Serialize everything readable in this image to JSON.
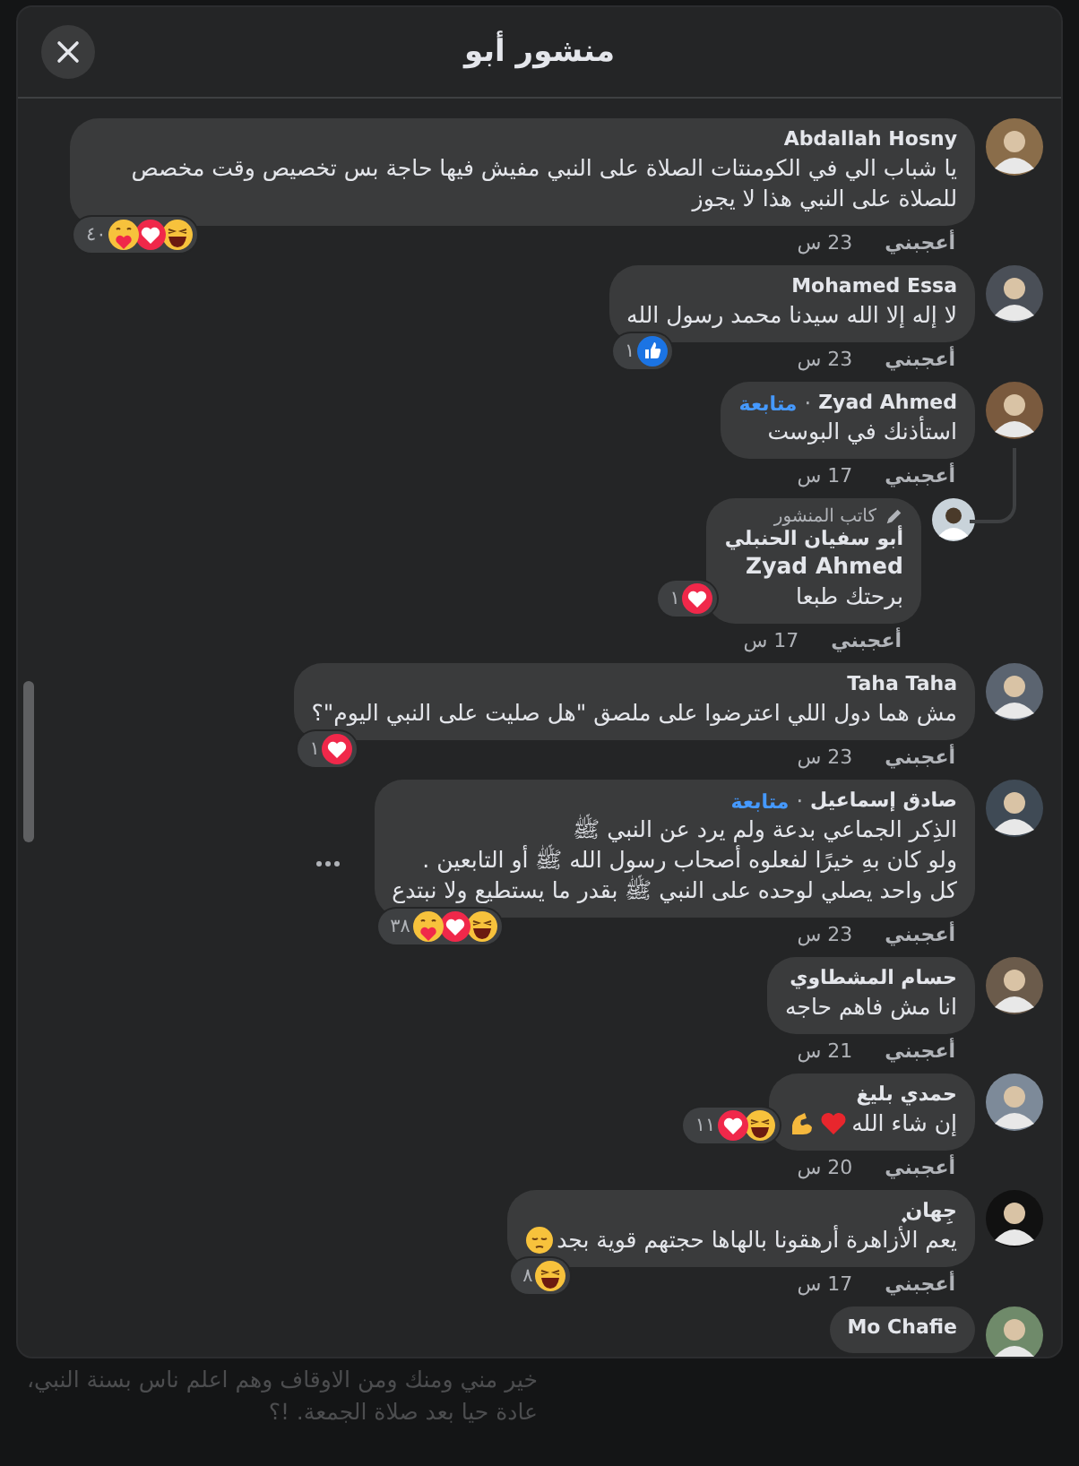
{
  "header": {
    "title": "منشور أبو"
  },
  "comments": [
    {
      "name": "Abdallah Hosny",
      "paragraphs": [
        "يا شباب الي في الكومنتات الصلاة على النبي مفيش فيها حاجة بس تخصيص وقت مخصص للصلاة على النبي هذا لا يجوز"
      ],
      "reactions": {
        "items": [
          {
            "kind": "haha"
          },
          {
            "kind": "love"
          },
          {
            "kind": "care"
          }
        ],
        "count": "٤٠"
      },
      "like": "أعجبني",
      "time": "23 س"
    },
    {
      "name": "Mohamed Essa",
      "paragraphs": [
        "لا إله إلا الله سيدنا محمد رسول الله"
      ],
      "reactions": {
        "items": [
          {
            "kind": "like"
          }
        ],
        "count": "١"
      },
      "like": "أعجبني",
      "time": "23 س"
    },
    {
      "name": "Zyad Ahmed",
      "separator": "·",
      "follow": "متابعة",
      "paragraphs": [
        "استأذنك في البوست"
      ],
      "like": "أعجبني",
      "time": "17 س",
      "replies": [
        {
          "author_badge": "كاتب المنشور",
          "name": "أبو سفيان الحنبلي",
          "mention": "Zyad Ahmed",
          "paragraphs": [
            "برحتك طبعا"
          ],
          "reactions": {
            "outside": true,
            "items": [
              {
                "kind": "love"
              }
            ],
            "count": "١"
          },
          "like": "أعجبني",
          "time": "17 س"
        }
      ]
    },
    {
      "name": "Taha Taha",
      "paragraphs": [
        "مش هما دول اللي اعترضوا على ملصق \"هل صليت على النبي اليوم\"؟"
      ],
      "reactions": {
        "items": [
          {
            "kind": "love"
          }
        ],
        "count": "١"
      },
      "like": "أعجبني",
      "time": "23 س"
    },
    {
      "name": "صادق إسماعيل",
      "separator": "·",
      "follow": "متابعة",
      "more_button": true,
      "paragraphs": [
        "الذِكر الجماعي بدعة ولم يرد عن النبي ﷺ",
        "ولو كان بهِ خيرًا لفعلوه أصحاب رسول الله ﷺ أو التابعين .",
        "كل واحد يصلي لوحده على النبي ﷺ بقدر ما يستطيع ولا نبتدع"
      ],
      "reactions": {
        "items": [
          {
            "kind": "haha"
          },
          {
            "kind": "love"
          },
          {
            "kind": "care"
          }
        ],
        "count": "٣٨"
      },
      "like": "أعجبني",
      "time": "23 س"
    },
    {
      "name": "حسام المشطاوي",
      "paragraphs": [
        "انا مش فاهم حاجه"
      ],
      "like": "أعجبني",
      "time": "21 س"
    },
    {
      "name": "حمدي بليغ",
      "paragraphs": [
        "إن شاء الله"
      ],
      "emojis": [
        {
          "kind": "heart"
        },
        {
          "kind": "muscle"
        }
      ],
      "reactions": {
        "outside": true,
        "items": [
          {
            "kind": "haha"
          },
          {
            "kind": "love"
          }
        ],
        "count": "١١"
      },
      "like": "أعجبني",
      "time": "20 س"
    },
    {
      "name": "جِهان ۪ٜ",
      "paragraphs": [
        "يعم الأزاهرة أرهقونا بالهاها حجتهم قوية بجد"
      ],
      "emojis": [
        {
          "kind": "pensive"
        }
      ],
      "reactions": {
        "items": [
          {
            "kind": "haha"
          }
        ],
        "count": "٨"
      },
      "like": "أعجبني",
      "time": "17 س"
    },
    {
      "name": "Mo Chafie"
    }
  ],
  "background_post": {
    "lines": [
      "خير مني ومنك ومن الاوقاف وهم اعلم ناس بسنة النبي،",
      "عادة حيا بعد صلاة الجمعة. !؟"
    ]
  }
}
